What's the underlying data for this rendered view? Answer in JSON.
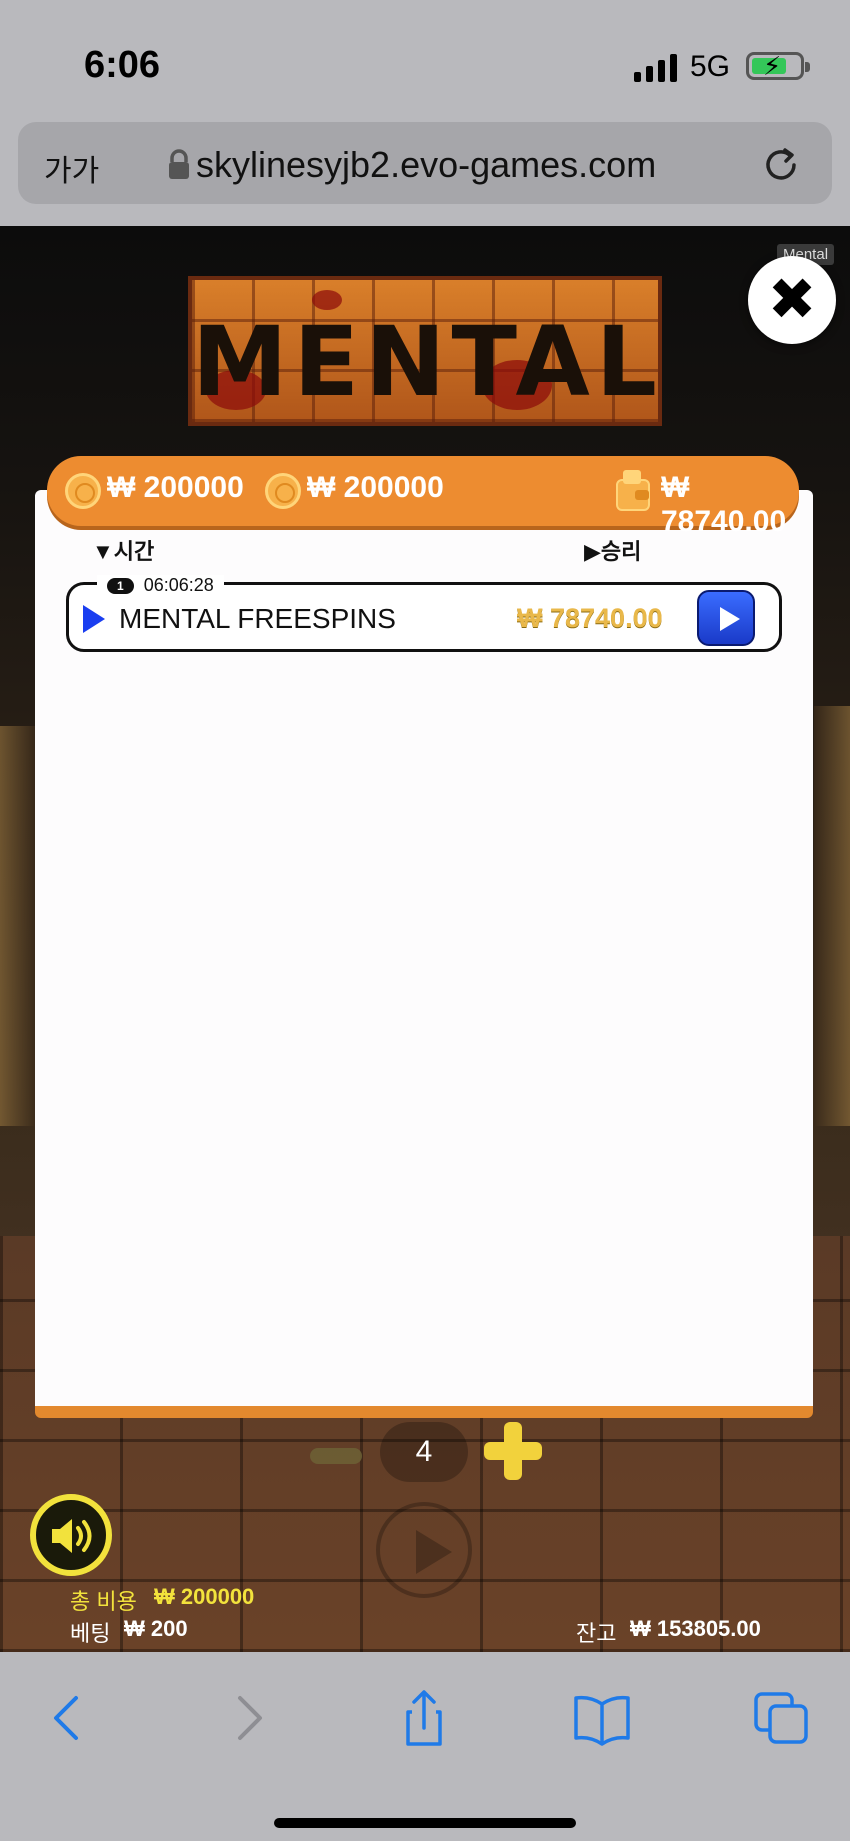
{
  "status_bar": {
    "time": "6:06",
    "network": "5G"
  },
  "browser": {
    "text_size_label": "가가",
    "url": "skylinesyjb2.evo-games.com"
  },
  "game": {
    "logo_text": "MENTAL",
    "tooltip": "Mental",
    "balance_bar": {
      "amount_1": "₩ 200000",
      "amount_2": "₩ 200000",
      "wallet_amount": "₩ 78740.00"
    },
    "history": {
      "col_time": "시간",
      "col_win": "승리",
      "rows": [
        {
          "index": "1",
          "time": "06:06:28",
          "title": "MENTAL FREESPINS",
          "amount": "₩ 78740.00"
        }
      ]
    },
    "controls": {
      "counter": "4"
    },
    "footer": {
      "total_cost_label": "총 비용",
      "total_cost_value": "₩ 200000",
      "bet_label": "베팅",
      "bet_value": "₩ 200",
      "balance_label": "잔고",
      "balance_value": "₩ 153805.00"
    }
  },
  "colors": {
    "accent_orange": "#ed8c30",
    "play_blue": "#1a3ef0",
    "gold": "#e9b84a",
    "yellow": "#f2e23c"
  }
}
